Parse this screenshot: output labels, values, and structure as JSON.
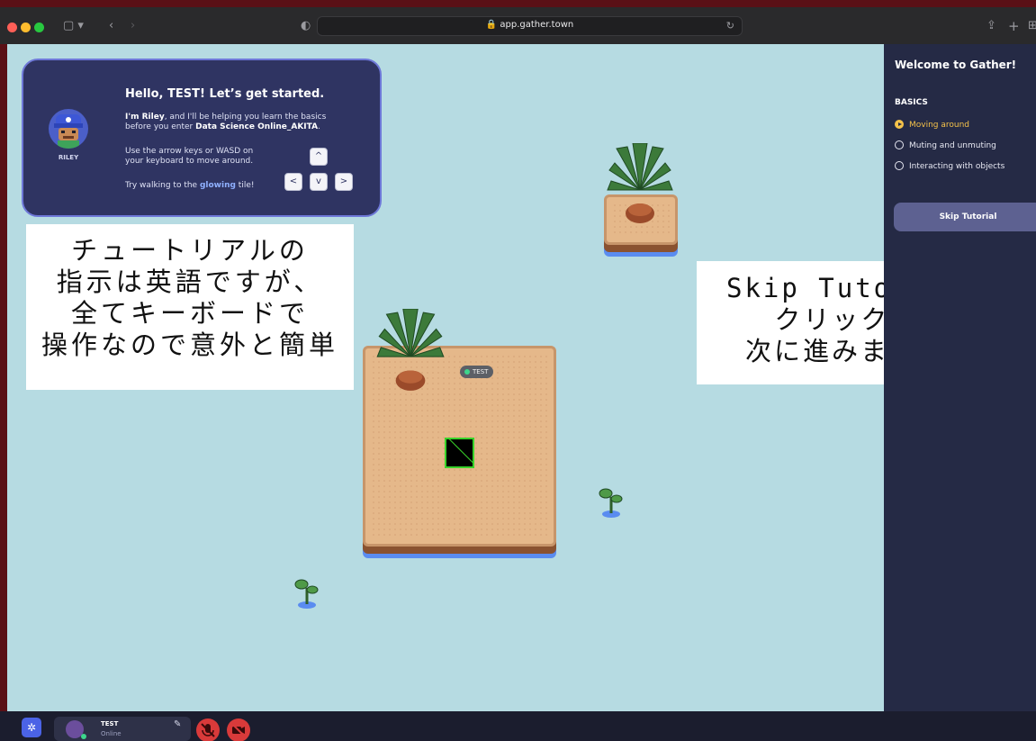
{
  "browser": {
    "url": "app.gather.town",
    "reload_icon": "reload-icon",
    "share_icon": "share-icon",
    "new_tab_icon": "plus-icon"
  },
  "tutorial": {
    "title": "Hello, TEST! Let’s get started.",
    "intro_bold": "I'm Riley",
    "intro_rest": ", and I'll be helping you learn the basics before you enter ",
    "space_name": "Data Science Online_AKITA",
    "intro_end": ".",
    "instructions": "Use the arrow keys or WASD on your keyboard to move around.",
    "try_prefix": "Try walking to the ",
    "glow_word": "glowing",
    "try_suffix": " tile!",
    "guide_name": "RILEY",
    "keys": {
      "up": "^",
      "left": "<",
      "down": "v",
      "right": ">"
    }
  },
  "map": {
    "player_tag": "TEST"
  },
  "annotations": {
    "left": [
      "チュートリアルの",
      "指示は英語ですが、",
      "全てキーボードで",
      "操作なので意外と簡単"
    ],
    "right": [
      "Skip Tutorialを",
      "クリックして",
      "次に進みましょう"
    ]
  },
  "side_panel": {
    "title": "Welcome to Gather!",
    "section": "BASICS",
    "steps": [
      "Moving around",
      "Muting and unmuting",
      "Interacting with objects"
    ],
    "active_step": 0,
    "skip_label": "Skip Tutorial",
    "accent_color": "#f5c24a"
  },
  "bottom_bar": {
    "user_name": "TEST",
    "user_status": "Online",
    "mic_state": "muted",
    "camera_state": "off"
  }
}
